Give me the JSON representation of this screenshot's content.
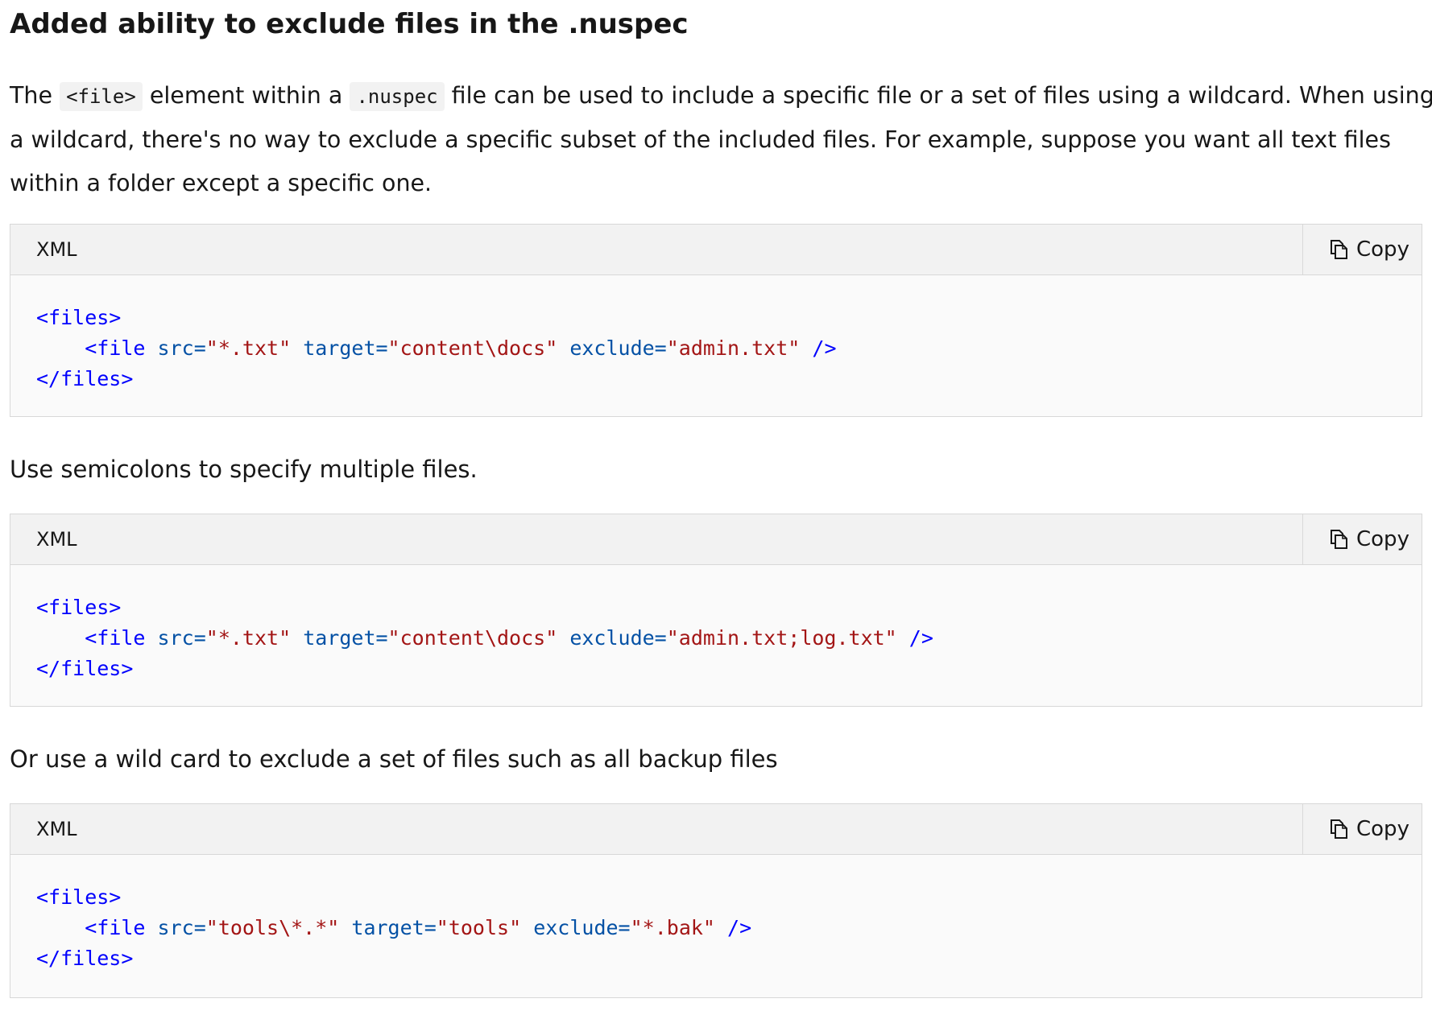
{
  "heading": "Added ability to exclude files in the .nuspec",
  "para1": {
    "t1": "The ",
    "code1": "<file>",
    "t2": " element within a ",
    "code2": ".nuspec",
    "t3": " file can be used to include a specific file or a set of files using a wildcard. When using",
    "line2": "a wildcard, there's no way to exclude a specific subset of the included files. For example, suppose you want all text files",
    "line3": "within a folder except a specific one."
  },
  "para2": "Use semicolons to specify multiple files.",
  "para3": "Or use a wild card to exclude a set of files such as all backup files",
  "copy_icon": "copy-icon",
  "code_blocks": [
    {
      "language": "XML",
      "copy_label": "Copy",
      "open_tag": "<files>",
      "file_open": "<file",
      "src_attr": "src=",
      "src_val": "\"*.txt\"",
      "target_attr": "target=",
      "target_val": "\"content\\docs\"",
      "exclude_attr": "exclude=",
      "exclude_val": "\"admin.txt\"",
      "self_close": "/>",
      "close_tag": "</files>"
    },
    {
      "language": "XML",
      "copy_label": "Copy",
      "open_tag": "<files>",
      "file_open": "<file",
      "src_attr": "src=",
      "src_val": "\"*.txt\"",
      "target_attr": "target=",
      "target_val": "\"content\\docs\"",
      "exclude_attr": "exclude=",
      "exclude_val": "\"admin.txt;log.txt\"",
      "self_close": "/>",
      "close_tag": "</files>"
    },
    {
      "language": "XML",
      "copy_label": "Copy",
      "open_tag": "<files>",
      "file_open": "<file",
      "src_attr": "src=",
      "src_val": "\"tools\\*.*\"",
      "target_attr": "target=",
      "target_val": "\"tools\"",
      "exclude_attr": "exclude=",
      "exclude_val": "\"*.bak\"",
      "self_close": "/>",
      "close_tag": "</files>"
    }
  ]
}
